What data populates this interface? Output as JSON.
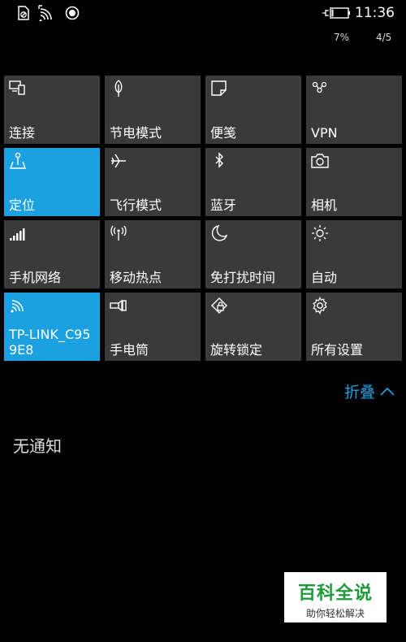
{
  "status_bar": {
    "time": "11:36",
    "battery_percent": "7%",
    "page_indicator": "4/5"
  },
  "tiles": [
    {
      "label": "连接",
      "icon": "connect-icon",
      "active": false
    },
    {
      "label": "节电模式",
      "icon": "battery-saver-icon",
      "active": false
    },
    {
      "label": "便笺",
      "icon": "note-icon",
      "active": false
    },
    {
      "label": "VPN",
      "icon": "vpn-icon",
      "active": false
    },
    {
      "label": "定位",
      "icon": "location-icon",
      "active": true
    },
    {
      "label": "飞行模式",
      "icon": "airplane-icon",
      "active": false
    },
    {
      "label": "蓝牙",
      "icon": "bluetooth-icon",
      "active": false
    },
    {
      "label": "相机",
      "icon": "camera-icon",
      "active": false
    },
    {
      "label": "手机网络",
      "icon": "cellular-icon",
      "active": false
    },
    {
      "label": "移动热点",
      "icon": "hotspot-icon",
      "active": false
    },
    {
      "label": "免打扰时间",
      "icon": "moon-icon",
      "active": false
    },
    {
      "label": "自动",
      "icon": "brightness-icon",
      "active": false
    },
    {
      "label": "TP-LINK_C959E8",
      "icon": "wifi-icon",
      "active": true
    },
    {
      "label": "手电筒",
      "icon": "flashlight-icon",
      "active": false
    },
    {
      "label": "旋转锁定",
      "icon": "rotation-lock-icon",
      "active": false
    },
    {
      "label": "所有设置",
      "icon": "settings-gear-icon",
      "active": false
    }
  ],
  "collapse_label": "折叠",
  "notifications_empty_text": "无通知",
  "watermark": {
    "title": "百科全说",
    "subtitle": "助你轻松解决"
  },
  "colors": {
    "accent": "#1ba1e2",
    "tile": "#3a3a3a",
    "background": "#000000"
  }
}
